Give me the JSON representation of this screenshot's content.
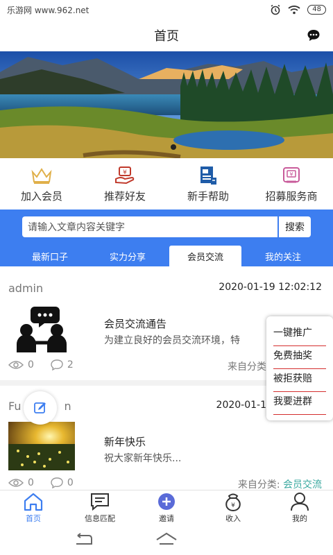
{
  "status": {
    "left_text": "乐游网 www.962.net",
    "battery": "48"
  },
  "header": {
    "title": "首页"
  },
  "quick_actions": [
    {
      "label": "加入会员",
      "icon": "crown-icon"
    },
    {
      "label": "推荐好友",
      "icon": "money-hand-icon"
    },
    {
      "label": "新手帮助",
      "icon": "help-doc-icon"
    },
    {
      "label": "招募服务商",
      "icon": "recruit-card-icon"
    }
  ],
  "search": {
    "placeholder": "请输入文章内容关键字",
    "button": "搜索"
  },
  "tabs": [
    {
      "label": "最新口子",
      "active": false
    },
    {
      "label": "实力分享",
      "active": false
    },
    {
      "label": "会员交流",
      "active": true
    },
    {
      "label": "我的关注",
      "active": false
    }
  ],
  "posts": [
    {
      "author": "admin",
      "time": "2020-01-19 12:02:12",
      "title": "会员交流通告",
      "desc": "为建立良好的会员交流环境，特",
      "views": "0",
      "comments": "2",
      "category_prefix": "来自分类",
      "category": ""
    },
    {
      "author": "Fu",
      "author_tail": "n",
      "time": "2020-01-1",
      "title": "新年快乐",
      "desc": "祝大家新年快乐...",
      "views": "0",
      "comments": "0",
      "category_prefix": "来自分类: ",
      "category": "会员交流"
    }
  ],
  "popup_menu": [
    "一键推广",
    "免费抽奖",
    "被拒获赔",
    "我要进群"
  ],
  "bottom_nav": [
    {
      "label": "首页",
      "icon": "home-icon",
      "active": true
    },
    {
      "label": "信息匹配",
      "icon": "message-icon",
      "active": false
    },
    {
      "label": "邀请",
      "icon": "plus-circle-icon",
      "active": false
    },
    {
      "label": "收入",
      "icon": "income-icon",
      "active": false
    },
    {
      "label": "我的",
      "icon": "user-icon",
      "active": false
    }
  ],
  "colors": {
    "primary": "#3d7ef0",
    "accent_red": "#d42d2d",
    "category": "#3ba9a0"
  }
}
